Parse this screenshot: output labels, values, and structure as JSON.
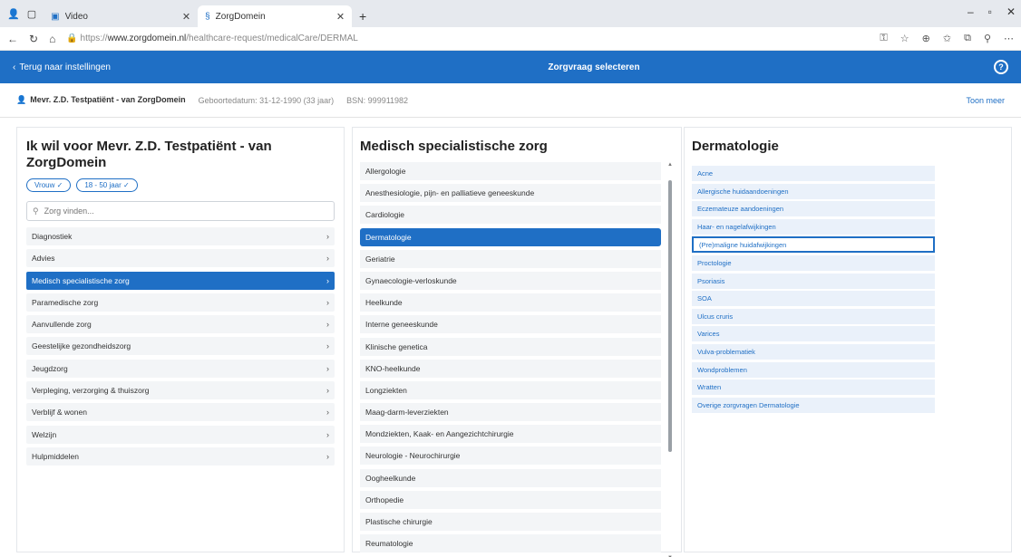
{
  "browser": {
    "tabs": [
      {
        "label": "Video",
        "active": false
      },
      {
        "label": "ZorgDomein",
        "active": true
      }
    ],
    "url_host": "www.zorgdomein.nl",
    "url_prefix": "https://",
    "url_path": "/healthcare-request/medicalCare/DERMAL"
  },
  "appbar": {
    "back_label": "Terug naar instellingen",
    "title": "Zorgvraag selecteren",
    "help_glyph": "?"
  },
  "patient": {
    "name": "Mevr. Z.D. Testpatiënt - van ZorgDomein",
    "dob": "Geboortedatum: 31-12-1990 (33 jaar)",
    "bsn": "BSN: 999911982",
    "right_link": "Toon meer"
  },
  "col1": {
    "title": "Ik wil voor Mevr. Z.D. Testpatiënt - van ZorgDomein",
    "chips": [
      "Vrouw ✓",
      "18 - 50 jaar ✓"
    ],
    "search_placeholder": "Zorg vinden...",
    "items": [
      {
        "label": "Diagnostiek",
        "selected": false
      },
      {
        "label": "Advies",
        "selected": false
      },
      {
        "label": "Medisch specialistische zorg",
        "selected": true
      },
      {
        "label": "Paramedische zorg",
        "selected": false
      },
      {
        "label": "Aanvullende zorg",
        "selected": false
      },
      {
        "label": "Geestelijke gezondheidszorg",
        "selected": false
      },
      {
        "label": "Jeugdzorg",
        "selected": false
      },
      {
        "label": "Verpleging, verzorging & thuiszorg",
        "selected": false
      },
      {
        "label": "Verblijf & wonen",
        "selected": false
      },
      {
        "label": "Welzijn",
        "selected": false
      },
      {
        "label": "Hulpmiddelen",
        "selected": false
      }
    ]
  },
  "col2": {
    "title": "Medisch specialistische zorg",
    "items": [
      {
        "label": "Allergologie",
        "selected": false
      },
      {
        "label": "Anesthesiologie, pijn- en palliatieve geneeskunde",
        "selected": false
      },
      {
        "label": "Cardiologie",
        "selected": false
      },
      {
        "label": "Dermatologie",
        "selected": true
      },
      {
        "label": "Geriatrie",
        "selected": false
      },
      {
        "label": "Gynaecologie-verloskunde",
        "selected": false
      },
      {
        "label": "Heelkunde",
        "selected": false
      },
      {
        "label": "Interne geneeskunde",
        "selected": false
      },
      {
        "label": "Klinische genetica",
        "selected": false
      },
      {
        "label": "KNO-heelkunde",
        "selected": false
      },
      {
        "label": "Longziekten",
        "selected": false
      },
      {
        "label": "Maag-darm-leverziekten",
        "selected": false
      },
      {
        "label": "Mondziekten, Kaak- en Aangezichtchirurgie",
        "selected": false
      },
      {
        "label": "Neurologie - Neurochirurgie",
        "selected": false
      },
      {
        "label": "Oogheelkunde",
        "selected": false
      },
      {
        "label": "Orthopedie",
        "selected": false
      },
      {
        "label": "Plastische chirurgie",
        "selected": false
      },
      {
        "label": "Reumatologie",
        "selected": false
      }
    ]
  },
  "col3": {
    "title": "Dermatologie",
    "items": [
      {
        "label": "Acne",
        "focus": false
      },
      {
        "label": "Allergische huidaandoeningen",
        "focus": false
      },
      {
        "label": "Eczemateuze aandoeningen",
        "focus": false
      },
      {
        "label": "Haar- en nagelafwijkingen",
        "focus": false
      },
      {
        "label": "(Pre)maligne huidafwijkingen",
        "focus": true
      },
      {
        "label": "Proctologie",
        "focus": false
      },
      {
        "label": "Psoriasis",
        "focus": false
      },
      {
        "label": "SOA",
        "focus": false
      },
      {
        "label": "Ulcus cruris",
        "focus": false
      },
      {
        "label": "Varices",
        "focus": false
      },
      {
        "label": "Vulva-problematiek",
        "focus": false
      },
      {
        "label": "Wondproblemen",
        "focus": false
      },
      {
        "label": "Wratten",
        "focus": false
      },
      {
        "label": "Overige zorgvragen Dermatologie",
        "focus": false
      }
    ]
  },
  "colors": {
    "accent": "#1f6fc5",
    "item_bg": "#f3f5f7",
    "derm_bg": "#eaf1fa"
  }
}
